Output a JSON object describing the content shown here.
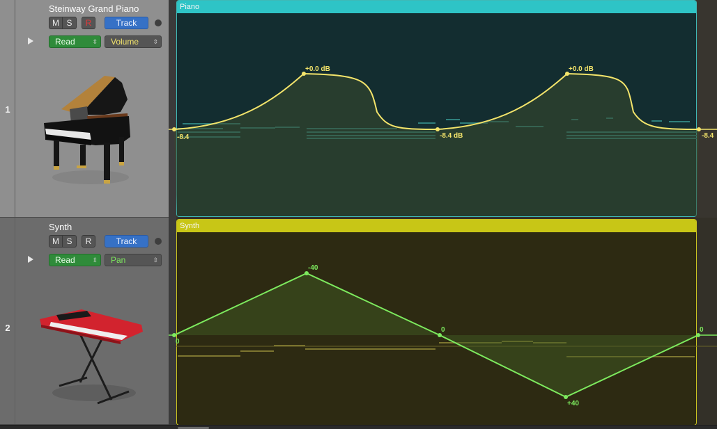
{
  "tracks": [
    {
      "number": "1",
      "name": "Steinway Grand Piano",
      "mute_label": "M",
      "solo_label": "S",
      "record_label": "R",
      "record_armed": true,
      "track_button_label": "Track",
      "automation_mode": "Read",
      "automation_parameter": "Volume",
      "instrument_icon": "grand-piano-icon",
      "region": {
        "name": "Piano",
        "color": "#2ec4c6",
        "automation_color": "#f3e46b",
        "automation_type": "curve",
        "points": [
          {
            "label": "-8.4",
            "value_db": -8.4
          },
          {
            "label": "+0.0 dB",
            "value_db": 0.0
          },
          {
            "label": "-8.4 dB",
            "value_db": -8.4
          },
          {
            "label": "+0.0 dB",
            "value_db": 0.0
          },
          {
            "label": "-8.4",
            "value_db": -8.4
          }
        ]
      }
    },
    {
      "number": "2",
      "name": "Synth",
      "mute_label": "M",
      "solo_label": "S",
      "record_label": "R",
      "record_armed": false,
      "track_button_label": "Track",
      "automation_mode": "Read",
      "automation_parameter": "Pan",
      "instrument_icon": "synth-keyboard-icon",
      "region": {
        "name": "Synth",
        "color": "#c8c616",
        "automation_color": "#7dea5e",
        "automation_type": "linear",
        "points": [
          {
            "label": "0",
            "value": 0
          },
          {
            "label": "-40",
            "value": -40
          },
          {
            "label": "0",
            "value": 0
          },
          {
            "label": "+40",
            "value": 40
          },
          {
            "label": "0",
            "value": 0
          }
        ]
      }
    }
  ],
  "colors": {
    "read_mode": "#2f8b3a",
    "track_button": "#3671c6",
    "volume_param_text": "#f3e46b",
    "pan_param_text": "#7dea5e"
  }
}
